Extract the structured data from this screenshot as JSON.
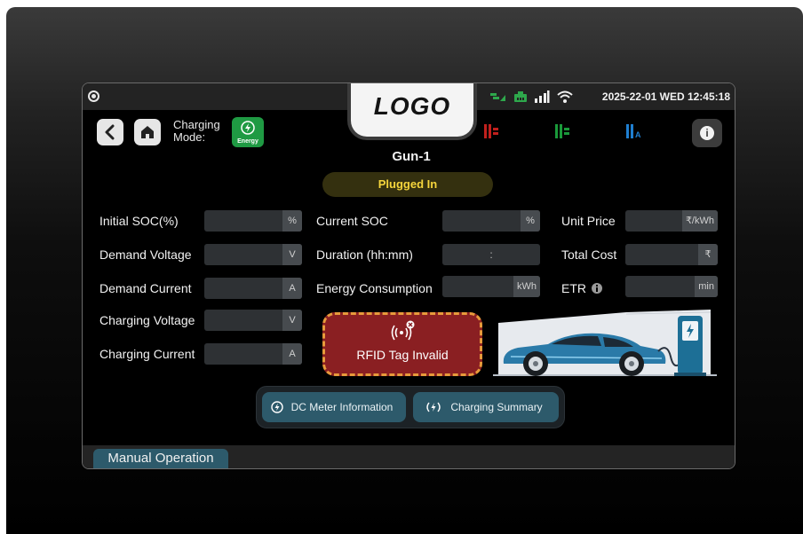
{
  "status_bar": {
    "datetime": "2025-22-01 WED 12:45:18"
  },
  "logo": "LOGO",
  "header": {
    "charging_mode_label_line1": "Charging",
    "charging_mode_label_line2": "Mode:",
    "energy_badge": "Energy",
    "gun": "Gun-1",
    "status": "Plugged In",
    "phase_icons": [
      {
        "name": "phase-r-icon",
        "color": "#c0201d"
      },
      {
        "name": "phase-y-icon",
        "color": "#1a9a3a"
      },
      {
        "name": "phase-a-icon",
        "color": "#1f7fd1",
        "letter": "A"
      }
    ]
  },
  "fields": {
    "initial_soc": {
      "label": "Initial SOC(%)",
      "unit": "%"
    },
    "demand_voltage": {
      "label": "Demand Voltage",
      "unit": "V"
    },
    "demand_current": {
      "label": "Demand Current",
      "unit": "A"
    },
    "charging_voltage": {
      "label": "Charging Voltage",
      "unit": "V"
    },
    "charging_current": {
      "label": "Charging Current",
      "unit": "A"
    },
    "current_soc": {
      "label": "Current SOC",
      "unit": "%"
    },
    "duration": {
      "label": "Duration (hh:mm)",
      "separator": ":"
    },
    "energy_consumption": {
      "label": "Energy Consumption",
      "unit": "kWh"
    },
    "unit_price": {
      "label": "Unit Price",
      "unit": "₹/kWh"
    },
    "total_cost": {
      "label": "Total Cost",
      "unit": "₹"
    },
    "etr": {
      "label": "ETR",
      "unit": "min"
    }
  },
  "rfid": {
    "message": "RFID Tag Invalid"
  },
  "buttons": {
    "dc_meter": "DC Meter Information",
    "charging_summary": "Charging Summary"
  },
  "footer": {
    "manual_operation": "Manual Operation"
  },
  "colors": {
    "accent": "#2d5a6b",
    "energy_green": "#1f9a43",
    "plugged_yellow": "#f5d53c",
    "rfid_red": "#8a1f22",
    "rfid_border": "#e89a3b"
  }
}
